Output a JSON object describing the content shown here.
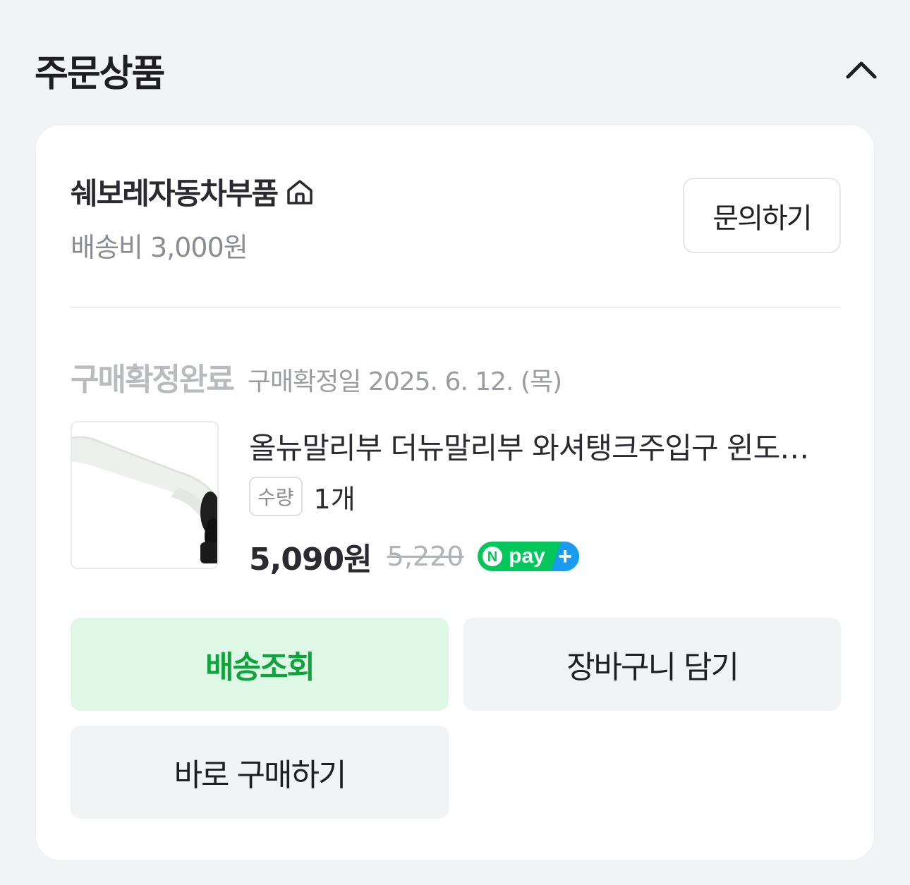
{
  "section": {
    "title": "주문상품",
    "collapse_icon": "chevron-up-icon"
  },
  "seller": {
    "name": "쉐보레자동차부품",
    "home_icon": "home-icon",
    "shipping_fee": "배송비 3,000원",
    "inquiry_label": "문의하기"
  },
  "order": {
    "status": "구매확정완료",
    "confirm_date": "구매확정일 2025. 6. 12. (목)"
  },
  "product": {
    "name": "올뉴말리부 더뉴말리부 와셔탱크주입구 윈도우액주입구 주입구",
    "quantity_label": "수량",
    "quantity_value": "1개",
    "price": "5,090원",
    "original_price": "5,220",
    "badge": {
      "label": "pay",
      "logo_letter": "N",
      "plus": "+",
      "colors": {
        "green": "#03c75a",
        "blue": "#1a9bf0"
      }
    }
  },
  "actions": {
    "track_label": "배송조회",
    "cart_label": "장바구니 담기",
    "buy_label": "바로 구매하기"
  },
  "colors": {
    "background": "#f2f3f5",
    "card": "#ffffff",
    "accent_green": "#0ea33c",
    "accent_green_bg": "#dff8e5"
  }
}
